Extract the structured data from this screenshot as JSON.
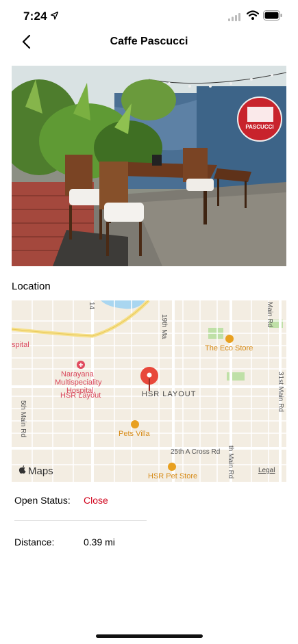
{
  "status_bar": {
    "time": "7:24",
    "location_icon": "location-arrow-icon",
    "signal_icon": "cellular-signal-icon",
    "wifi_icon": "wifi-icon",
    "battery_icon": "battery-icon"
  },
  "nav": {
    "title": "Caffe Pascucci",
    "back_icon": "chevron-left-icon"
  },
  "hero_image": {
    "sign_text": "PASCUCCI"
  },
  "location": {
    "label": "Location"
  },
  "map": {
    "pin_label": "HSR LAYOUT",
    "pois": {
      "eco_store": "The Eco Store",
      "hospital_line1": "Narayana",
      "hospital_line2": "Multispeciality",
      "hospital_line3": "Hospital,",
      "hospital_line4": "HSR Layout",
      "hospital_edge": "spital",
      "pets_villa": "Pets Villa",
      "pet_store": "HSR Pet Store"
    },
    "roads": {
      "r19th": "19th Ma",
      "r14": "14",
      "main_rd": "Main Rd",
      "r31st": "31st Main Rd",
      "r5th": "5th Main Rd",
      "r25th": "25th A Cross Rd",
      "rth_main": "th Main Rd"
    },
    "attribution": "Maps",
    "legal": "Legal",
    "colors": {
      "land": "#f3ede2",
      "park": "#bfe0a7",
      "water": "#a9d6f0",
      "pin": "#e8483b"
    }
  },
  "details": {
    "open_status_label": "Open Status:",
    "open_status_value": "Close",
    "distance_label": "Distance:",
    "distance_value": "0.39 mi",
    "status_color": "#d0021b"
  }
}
